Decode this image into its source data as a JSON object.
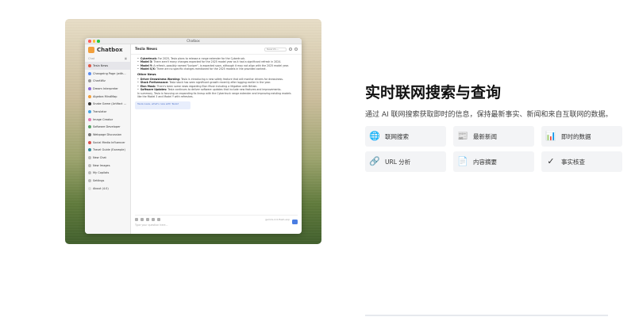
{
  "app": {
    "window_title": "Chatbox",
    "brand": "Chatbox",
    "sidebar_header": "Chat",
    "sidebar_items": [
      {
        "label": "Tesla News",
        "active": true,
        "color": "#e05a47"
      },
      {
        "label": "Changeing Page (with...",
        "active": false,
        "color": "#5b8def"
      },
      {
        "label": "ChartWiz",
        "active": false,
        "color": "#9a9a9a"
      },
      {
        "label": "Dream Interpreter",
        "active": false,
        "color": "#8a6bd6"
      },
      {
        "label": "Algebra MindMap",
        "active": false,
        "color": "#f2a03d"
      },
      {
        "label": "Snake Game (Artifact ...",
        "active": false,
        "color": "#333333"
      },
      {
        "label": "Translator",
        "active": false,
        "color": "#4aa3df"
      },
      {
        "label": "Image Creator",
        "active": false,
        "color": "#e07ab0"
      },
      {
        "label": "Software Developer",
        "active": false,
        "color": "#5aa469"
      },
      {
        "label": "Webpage Discussion",
        "active": false,
        "color": "#777777"
      },
      {
        "label": "Social Media Influencer",
        "active": false,
        "color": "#d9534f"
      },
      {
        "label": "Travel Guide (Example)",
        "active": false,
        "color": "#3b8d99"
      },
      {
        "label": "New Chat",
        "active": false,
        "color": "#bbbbbb"
      },
      {
        "label": "New Images",
        "active": false,
        "color": "#bbbbbb"
      },
      {
        "label": "My Copilots",
        "active": false,
        "color": "#bbbbbb"
      },
      {
        "label": "Settings",
        "active": false,
        "color": "#bbbbbb"
      },
      {
        "label": "About (4.0)",
        "active": false,
        "color": "#dddddd"
      }
    ],
    "chat_title": "Tesla News",
    "search_placeholder": "Search...",
    "bullets_top": [
      {
        "bold": "Cybertruck:",
        "text": "For 2025, Tesla plans to release a range extender for the Cybertruck."
      },
      {
        "bold": "Model 3:",
        "text": "There aren't many changes expected for the 2025 model year as it had a significant refresh in 2024."
      },
      {
        "bold": "Model Y:",
        "text": "A refresh, possibly named \"Juniper\", is expected soon, although it may not align with the 2025 model year."
      },
      {
        "bold": "Model S/X:",
        "text": "There are no specific changes mentioned for the 2025 models in the provided context."
      }
    ],
    "section_heading": "Other News",
    "bullets_bottom": [
      {
        "bold": "Driver Drowsiness Warning:",
        "text": "Tesla is introducing a new safety feature that will monitor drivers for drowsiness."
      },
      {
        "bold": "Stock Performance:",
        "text": "Tesla stock has seen significant growth recently after lagging earlier in the year."
      },
      {
        "bold": "Elon Musk:",
        "text": "There's been some news regarding Elon Musk including a litigation with Britain."
      },
      {
        "bold": "Software Updates:",
        "text": "Tesla continues to deliver software updates that include new features and improvements."
      }
    ],
    "summary": "In summary, Tesla is focusing on expanding its lineup with the Cybertruck range extender and improving existing models like the Model 3 and Model Y with refreshes.",
    "bubble_text": "Tesla news, what's new with Tesla?",
    "composer_placeholder": "Type your question here...",
    "model_label": "gemini-2.0-flash-exp"
  },
  "headline": "实时联网搜索与查询",
  "subline": "通过 AI 联网搜索获取即时的信息，保持最新事实、新闻和来自互联网的数据。",
  "features": [
    {
      "label": "联网搜索",
      "icon": "globe-icon",
      "glyph": "🌐"
    },
    {
      "label": "最新新闻",
      "icon": "newspaper-icon",
      "glyph": "📰"
    },
    {
      "label": "即时的数据",
      "icon": "bar-chart-icon",
      "glyph": "📊"
    },
    {
      "label": "URL 分析",
      "icon": "link-icon",
      "glyph": "🔗"
    },
    {
      "label": "内容摘要",
      "icon": "document-icon",
      "glyph": "📄"
    },
    {
      "label": "事实核查",
      "icon": "checkmark-icon",
      "glyph": "✓"
    }
  ]
}
